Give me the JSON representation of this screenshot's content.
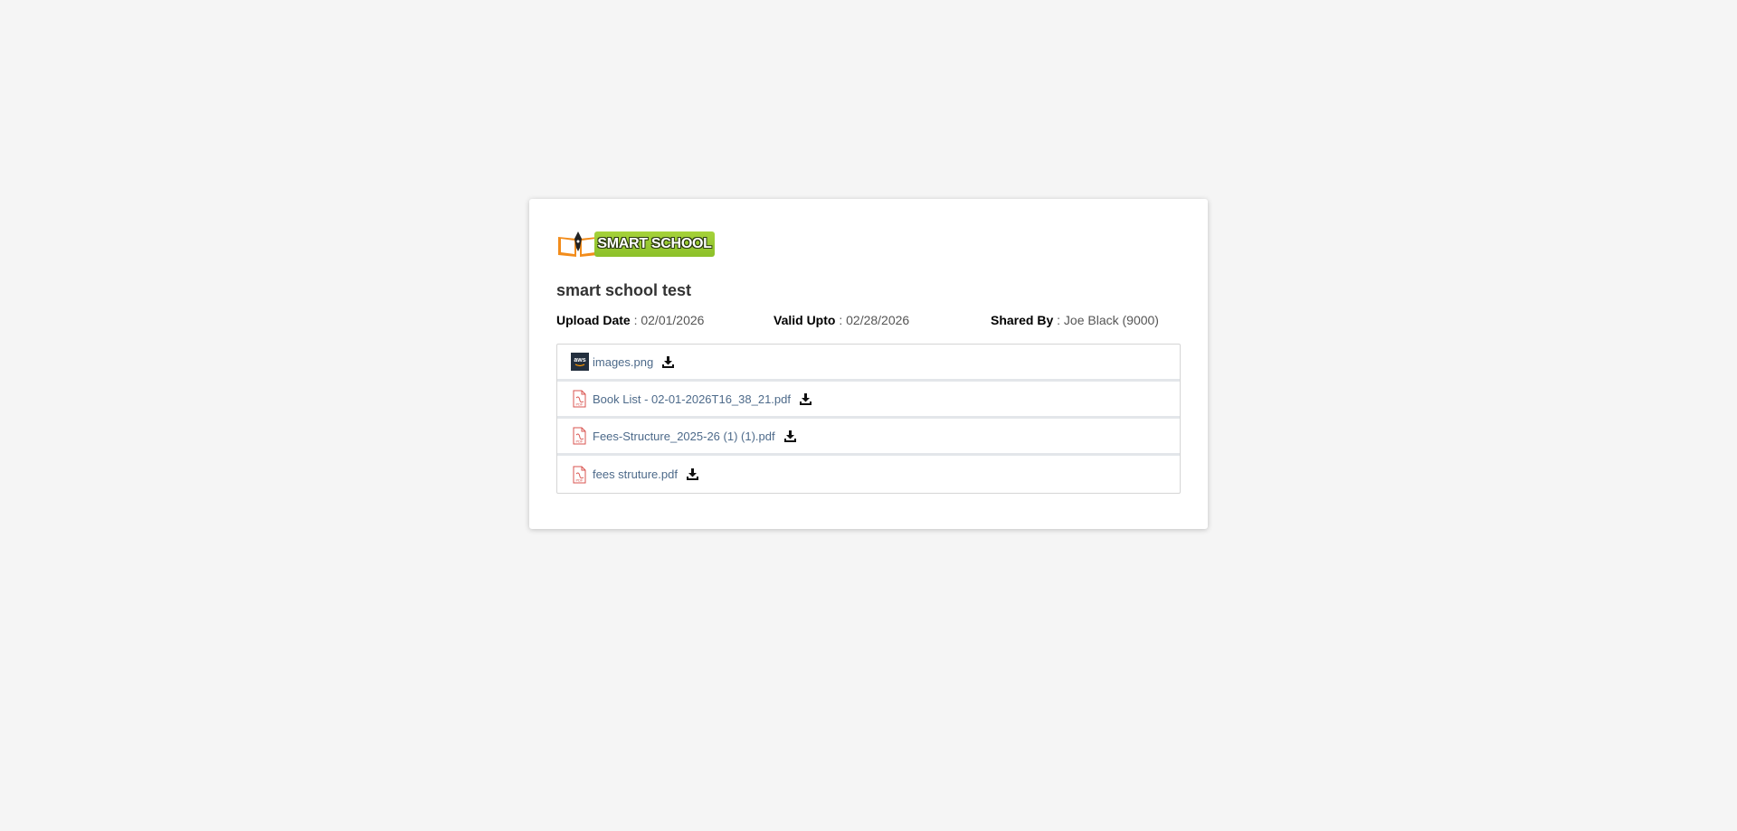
{
  "logo": {
    "text": "SMART SCHOOL"
  },
  "title": "smart school test",
  "meta": {
    "upload_label": "Upload Date",
    "upload_value": " : 02/01/2026",
    "valid_label": "Valid Upto",
    "valid_value": " : 02/28/2026",
    "shared_label": "Shared By",
    "shared_value": " : Joe Black (9000)"
  },
  "files": [
    {
      "name": "images.png",
      "icon": "aws-image-icon"
    },
    {
      "name": "Book List - 02-01-2026T16_38_21.pdf",
      "icon": "pdf-icon"
    },
    {
      "name": "Fees-Structure_2025-26 (1) (1).pdf",
      "icon": "pdf-icon"
    },
    {
      "name": "fees struture.pdf",
      "icon": "pdf-icon"
    }
  ],
  "colors": {
    "background": "#f5f5f5",
    "link": "#4d6a8a",
    "logo_green": "#9ccc35",
    "logo_orange": "#f28c1b"
  }
}
